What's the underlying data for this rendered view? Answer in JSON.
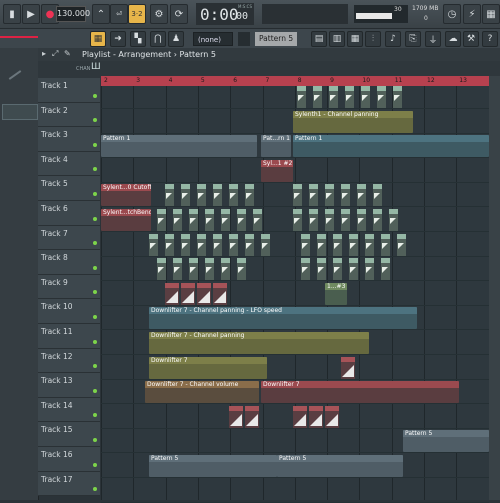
{
  "transport": {
    "tempo": "130.000",
    "time": "0:00",
    "time_sub": "00",
    "time_label": "M:S:CS",
    "cpu_value": "30",
    "mem": "1709 MB",
    "mem_sub": "0"
  },
  "toolbar2": {
    "pattern_selector": "(none)",
    "pattern_name": "Pattern 5"
  },
  "playlist": {
    "breadcrumb_1": "Playlist",
    "breadcrumb_2": "Arrangement",
    "breadcrumb_3": "Pattern 5",
    "mode_chan": "CHAN"
  },
  "ruler": {
    "bars": [
      "2",
      "3",
      "4",
      "5",
      "6",
      "7",
      "8",
      "9",
      "10",
      "11",
      "12",
      "13"
    ]
  },
  "tracks": [
    "Track 1",
    "Track 2",
    "Track 3",
    "Track 4",
    "Track 5",
    "Track 6",
    "Track 7",
    "Track 8",
    "Track 9",
    "Track 10",
    "Track 11",
    "Track 12",
    "Track 13",
    "Track 14",
    "Track 15",
    "Track 16",
    "Track 17"
  ],
  "clips": {
    "c2": "Sylenth1 - Channel panning",
    "c3a": "Pattern 1",
    "c3b": "Pat...rn 1",
    "c3c": "Pattern 1",
    "c4": "Syl...1 #2",
    "c5": "Sylent...0 Cutoff",
    "c6": "Sylent...tchBend",
    "c9": "1...#3",
    "c10": "Downlifter 7 - Channel panning - LFO speed",
    "c11": "Downlifter 7 - Channel panning",
    "c12": "Downlifter 7",
    "c13a": "Downlifter 7 - Channel volume",
    "c13b": "Downlifter 7",
    "c15": "Pattern 5",
    "c16a": "Pattern 5",
    "c16b": "Pattern 5"
  },
  "colors": {
    "accent_red": "#b7414f",
    "accent_yellow": "#e7b54a",
    "status_green": "#7dd44a"
  }
}
